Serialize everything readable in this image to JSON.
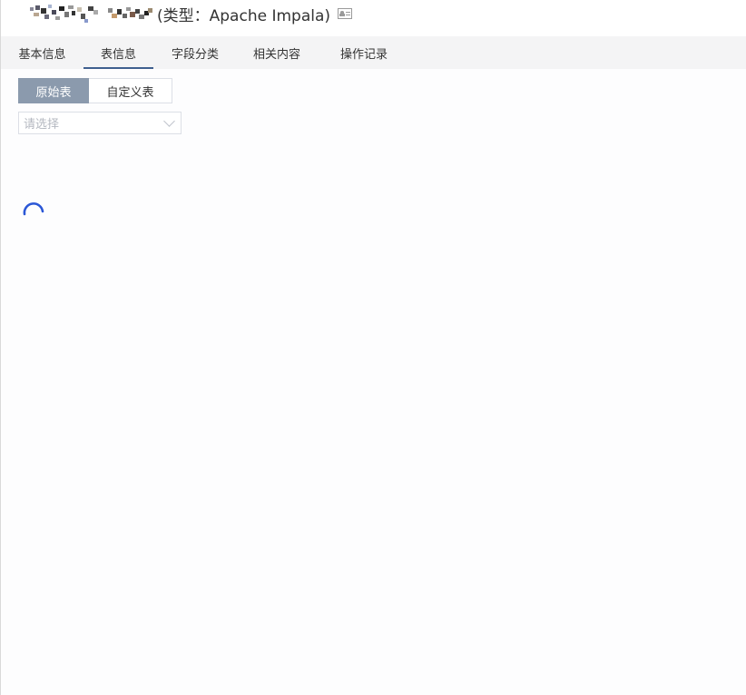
{
  "header": {
    "title_type": "(类型：Apache Impala)",
    "id_card_icon": "id-card-icon"
  },
  "tabs": [
    {
      "label": "基本信息",
      "active": false
    },
    {
      "label": "表信息",
      "active": true
    },
    {
      "label": "字段分类",
      "active": false
    },
    {
      "label": "相关内容",
      "active": false
    },
    {
      "label": "操作记录",
      "active": false
    }
  ],
  "table_mode": {
    "options": [
      "原始表",
      "自定义表"
    ],
    "selected": "原始表"
  },
  "table_select": {
    "placeholder": "请选择",
    "icon": "chevron-down-icon"
  },
  "loading": {
    "icon": "loading-spinner-icon",
    "color": "#2b57d6"
  },
  "colors": {
    "tab_bar_bg": "#f4f4f5",
    "tab_active_underline": "#3f5f8f",
    "segment_active_bg": "#8b9aad"
  }
}
